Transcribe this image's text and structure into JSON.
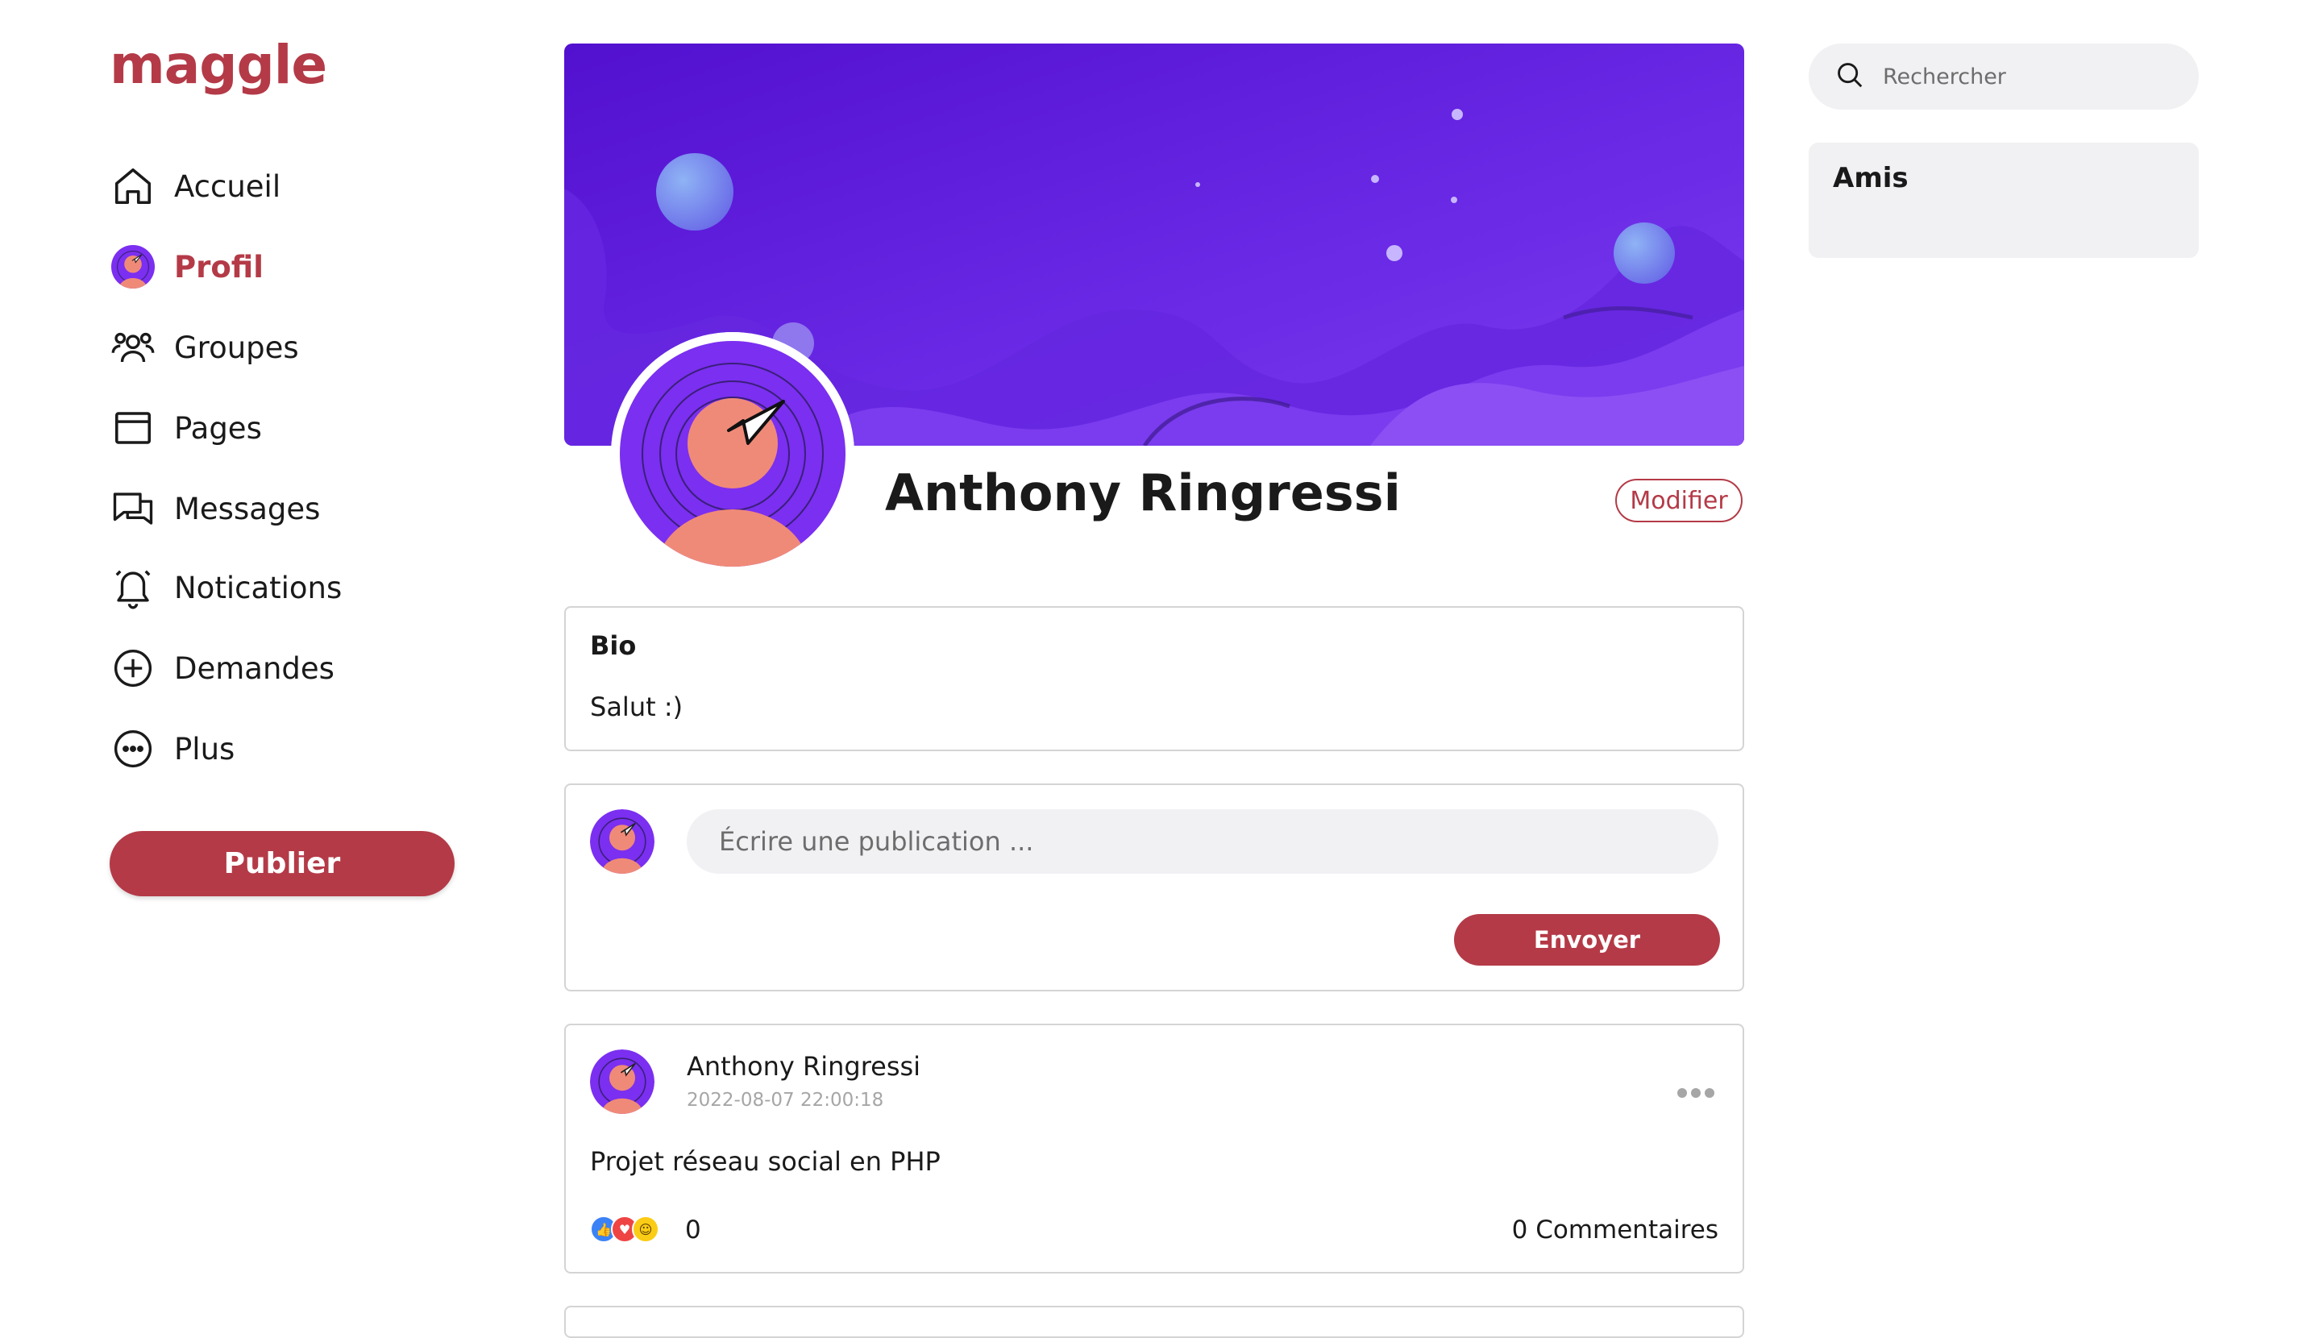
{
  "brand": {
    "logo_text": "maggle",
    "accent_color": "#b43a47"
  },
  "sidebar": {
    "items": [
      {
        "label": "Accueil",
        "icon": "home-icon"
      },
      {
        "label": "Profil",
        "icon": "avatar-icon",
        "active": true
      },
      {
        "label": "Groupes",
        "icon": "users-icon"
      },
      {
        "label": "Pages",
        "icon": "page-icon"
      },
      {
        "label": "Messages",
        "icon": "messages-icon"
      },
      {
        "label": "Notications",
        "icon": "bell-icon"
      },
      {
        "label": "Demandes",
        "icon": "plus-circle-icon"
      },
      {
        "label": "Plus",
        "icon": "more-circle-icon"
      }
    ],
    "publish_label": "Publier"
  },
  "profile": {
    "name": "Anthony Ringressi",
    "edit_label": "Modifier",
    "cover_colors": [
      "#5b17d6",
      "#7a38ee"
    ]
  },
  "bio": {
    "title": "Bio",
    "text": "Salut :)"
  },
  "composer": {
    "placeholder": "Écrire une publication ...",
    "send_label": "Envoyer"
  },
  "posts": [
    {
      "author": "Anthony Ringressi",
      "date": "2022-08-07 22:00:18",
      "text": "Projet réseau social en PHP",
      "reaction_icons": [
        "like-icon",
        "love-icon",
        "wow-icon"
      ],
      "reactions_count": "0",
      "comments_label": "0 Commentaires",
      "menu_icon": "more-dots-icon"
    }
  ],
  "right": {
    "search_placeholder": "Rechercher",
    "friends_title": "Amis"
  }
}
